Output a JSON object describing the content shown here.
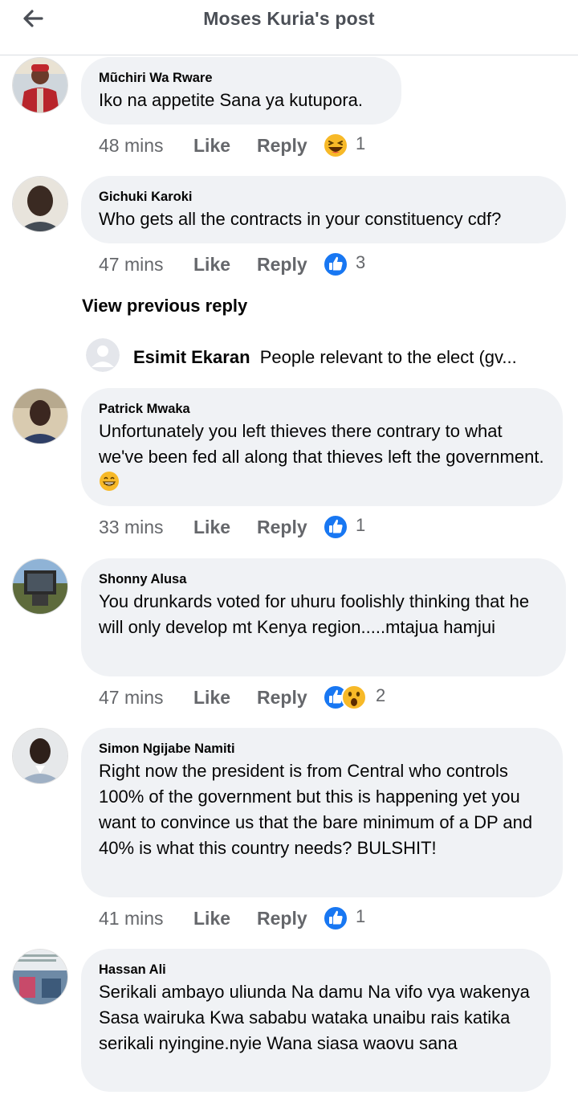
{
  "header": {
    "title": "Moses Kuria's post",
    "back_icon": "arrow-left-icon"
  },
  "actions": {
    "like": "Like",
    "reply": "Reply"
  },
  "comments": [
    {
      "name": "Mũchiri Wa Rware",
      "text": "Iko na appetite Sana ya kutupora.",
      "time": "48 mins",
      "reactions": [
        "haha"
      ],
      "count": "1"
    },
    {
      "name": "Gichuki Karoki",
      "text": "Who gets all the contracts in your constituency cdf?",
      "time": "47 mins",
      "reactions": [
        "like"
      ],
      "count": "3"
    },
    {
      "name": "Patrick Mwaka",
      "text": "Unfortunately you left thieves there contrary to what we've been fed all along that thieves left the government.",
      "emoji": "grin",
      "time": "33 mins",
      "reactions": [
        "like"
      ],
      "count": "1"
    },
    {
      "name": "Shonny Alusa",
      "text": "You drunkards voted for uhuru foolishly thinking that he will only develop mt Kenya region.....mtajua hamjui",
      "time": "47 mins",
      "reactions": [
        "like",
        "wow"
      ],
      "count": "2"
    },
    {
      "name": "Simon Ngijabe Namiti",
      "text": "Right now the president is from Central who controls 100% of the government but this is happening yet you want to convince us that the bare minimum of a DP and 40% is what this country needs? BULSHIT!",
      "time": "41 mins",
      "reactions": [
        "like"
      ],
      "count": "1"
    },
    {
      "name": "Hassan Ali",
      "text": "Serikali ambayo uliunda Na damu Na vifo vya wakenya Sasa wairuka Kwa sababu wataka unaibu rais katika serikali nyingine.nyie Wana siasa waovu sana"
    }
  ],
  "view_previous": "View previous reply",
  "sub_reply": {
    "name": "Esimit Ekaran",
    "text": "People relevant to the  elect (gv..."
  },
  "colors": {
    "bubble": "#f0f2f5",
    "muted": "#65676b",
    "like_blue": "#1877f2",
    "haha_yellow": "#f7b928"
  }
}
